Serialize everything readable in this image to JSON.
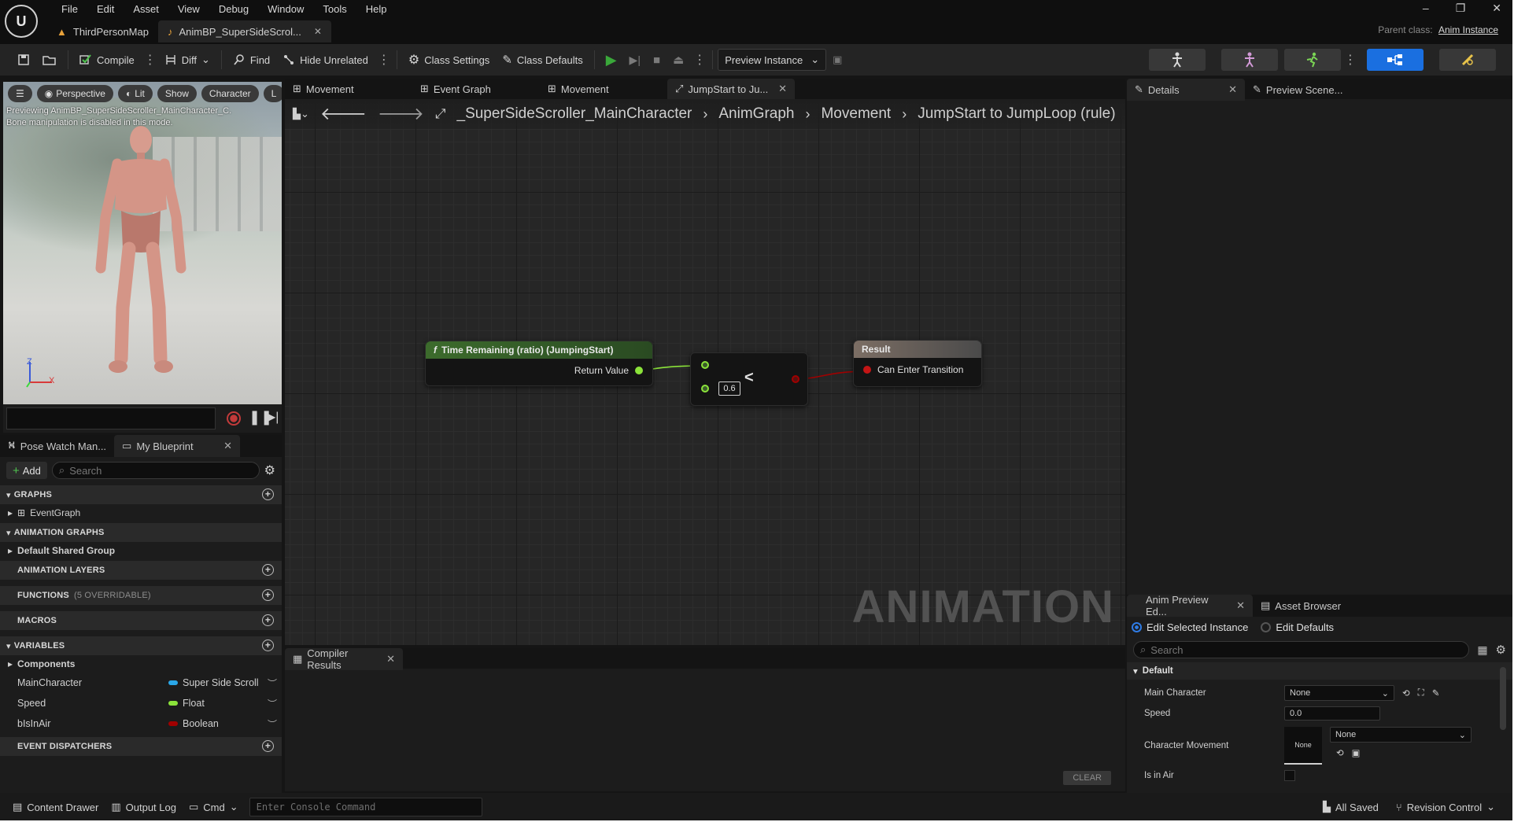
{
  "menu": [
    "File",
    "Edit",
    "Asset",
    "View",
    "Debug",
    "Window",
    "Tools",
    "Help"
  ],
  "doc_tabs": [
    {
      "label": "ThirdPersonMap"
    },
    {
      "label": "AnimBP_SuperSideScrol..."
    }
  ],
  "parent_class": {
    "label": "Parent class:",
    "value": "Anim Instance"
  },
  "toolbar": {
    "compile": "Compile",
    "diff": "Diff",
    "find": "Find",
    "hide_unrelated": "Hide Unrelated",
    "class_settings": "Class Settings",
    "class_defaults": "Class Defaults",
    "preview_instance": "Preview Instance"
  },
  "viewport": {
    "pills": [
      "Perspective",
      "Lit",
      "Show",
      "Character",
      "L"
    ],
    "message_line1": "Previewing AnimBP_SuperSideScroller_MainCharacter_C.",
    "message_line2": "Bone manipulation is disabled in this mode.",
    "axis_z": "Z",
    "axis_x": "X"
  },
  "left_panel": {
    "tabs": [
      "Pose Watch Man...",
      "My Blueprint"
    ],
    "add_label": "Add",
    "search_placeholder": "Search",
    "graphs_header": "GRAPHS",
    "event_graph": "EventGraph",
    "animation_graphs_header": "ANIMATION GRAPHS",
    "default_shared_group": "Default Shared Group",
    "animation_layers_header": "ANIMATION LAYERS",
    "functions_header": "FUNCTIONS",
    "functions_sub": "(5 OVERRIDABLE)",
    "macros_header": "MACROS",
    "variables_header": "VARIABLES",
    "components": "Components",
    "variables": [
      {
        "name": "MainCharacter",
        "type": "Super Side Scroll",
        "color": "#2aa7e8"
      },
      {
        "name": "Speed",
        "type": "Float",
        "color": "#8be33a"
      },
      {
        "name": "bIsInAir",
        "type": "Boolean",
        "color": "#a10000"
      }
    ],
    "event_dispatchers_header": "EVENT DISPATCHERS"
  },
  "graph_tabs": [
    "Movement",
    "Event Graph",
    "Movement",
    "JumpStart to Ju..."
  ],
  "breadcrumb": [
    "_SuperSideScroller_MainCharacter",
    "AnimGraph",
    "Movement",
    "JumpStart to JumpLoop (rule)"
  ],
  "nodes": {
    "time_remaining": {
      "title": "Time Remaining (ratio) (JumpingStart)",
      "pin": "Return Value"
    },
    "compare": {
      "op": "<",
      "value": "0.6"
    },
    "result": {
      "title": "Result",
      "pin": "Can Enter Transition"
    }
  },
  "watermark": "ANIMATION",
  "compiler": {
    "tab": "Compiler Results",
    "clear": "CLEAR"
  },
  "details": {
    "tabs": [
      "Details",
      "Preview Scene..."
    ]
  },
  "anim_preview": {
    "tabs": [
      "Anim Preview Ed...",
      "Asset Browser"
    ],
    "edit_selected": "Edit Selected Instance",
    "edit_defaults": "Edit Defaults",
    "search_placeholder": "Search",
    "section": "Default",
    "props": {
      "main_character": {
        "label": "Main Character",
        "value": "None"
      },
      "speed": {
        "label": "Speed",
        "value": "0.0"
      },
      "character_movement": {
        "label": "Character Movement",
        "thumb": "None",
        "value": "None"
      },
      "is_in_air": {
        "label": "Is in Air"
      }
    }
  },
  "statusbar": {
    "content_drawer": "Content Drawer",
    "output_log": "Output Log",
    "cmd": "Cmd",
    "console_placeholder": "Enter Console Command",
    "all_saved": "All Saved",
    "revision_control": "Revision Control"
  },
  "colors": {
    "accent": "#1a6fe0",
    "function_node_header": "#3c6b2c",
    "result_node_header": "#6b6b6b",
    "float_pin": "#8be33a",
    "bool_pin": "#a10000",
    "play_green": "#3aa83a"
  }
}
